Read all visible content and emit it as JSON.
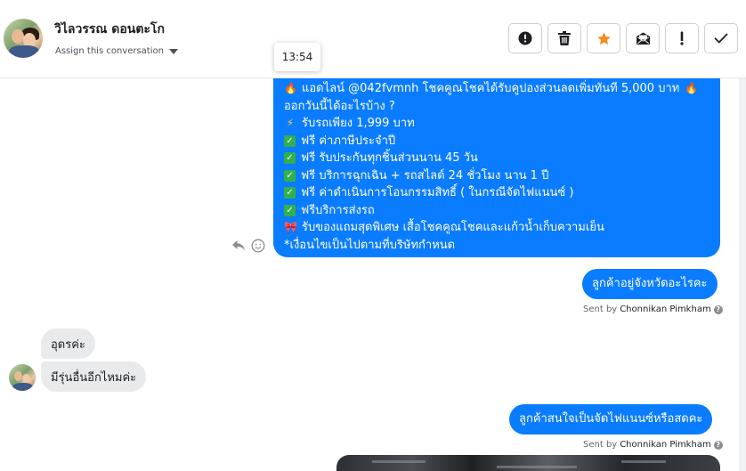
{
  "header": {
    "contact_name": "วิไลวรรณ ดอนตะโก",
    "assign_label": "Assign this conversation",
    "actions": [
      {
        "name": "mark-spam-button",
        "icon": "alert-circle-icon"
      },
      {
        "name": "delete-button",
        "icon": "trash-icon"
      },
      {
        "name": "star-button",
        "icon": "star-icon"
      },
      {
        "name": "mark-unread-button",
        "icon": "envelope-icon"
      },
      {
        "name": "follow-up-button",
        "icon": "exclamation-icon"
      },
      {
        "name": "done-button",
        "icon": "check-icon"
      }
    ],
    "star_color": "#f68b1e"
  },
  "time_tooltip": "13:54",
  "messages": {
    "promo": {
      "line1_text": "แอดไลน์ @042fvmnh โชคคูณโชคได้รับคูปองส่วนลดเพิ่มทันที 5,000 บาท",
      "line2": "ออกวันนี้ได้อะไรบ้าง ?",
      "line3": "รับรถเพียง 1,999 บาท",
      "line4": "ฟรี ค่าภาษีประจำปี",
      "line5": "ฟรี รับประกันทุกชิ้นส่วนนาน 45 วัน",
      "line6": "ฟรี บริการฉุกเฉิน + รถสไลด์ 24 ชั่วโมง นาน 1 ปี",
      "line7": "ฟรี ค่าดำเนินการโอนกรรมสิทธิ์ ( ในกรณีจัดไฟแนนซ์ )",
      "line8": "ฟรีบริการส่งรถ",
      "line9": "รับของแถมสุดพิเศษ เสื้อโชคคูณโชคและแก้วน้ำเก็บความเย็น",
      "line10": "*เงื่อนไขเป็นไปตามที่บริษัทกำหนด"
    },
    "out_province": "ลูกค้าอยู่จังหวัดอะไรคะ",
    "in_reply1": "อุดรค่ะ",
    "in_reply2": "มีรุ่นอื่นอีกไหมค่ะ",
    "out_finance": "ลูกค้าสนใจเป็นจัดไฟแนนซ์หรือสดคะ",
    "sent_by_label": "Sent by",
    "sent_by_agent": "Chonnikan Pimkham"
  },
  "colors": {
    "outgoing_bubble": "#0a7cff",
    "incoming_bubble": "#e9eaec"
  }
}
